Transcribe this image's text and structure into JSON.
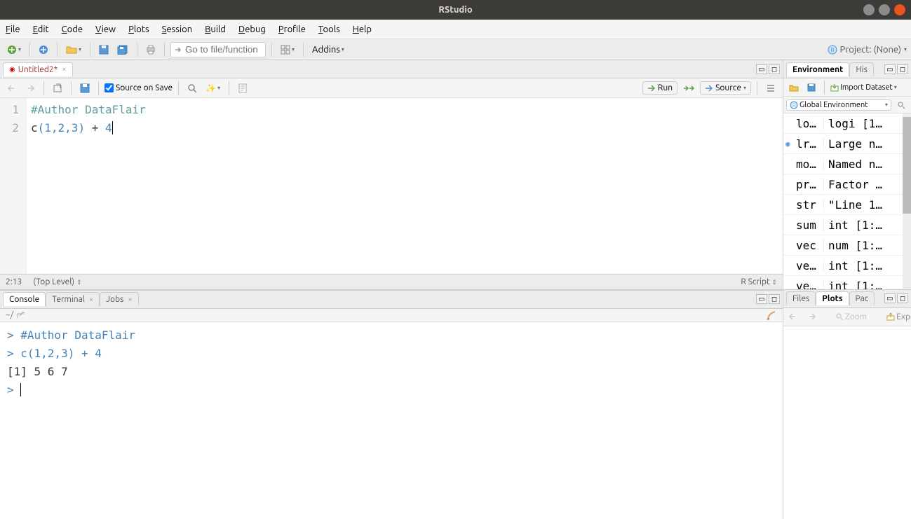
{
  "window": {
    "title": "RStudio"
  },
  "menu": {
    "file": "File",
    "edit": "Edit",
    "code": "Code",
    "view": "View",
    "plots": "Plots",
    "session": "Session",
    "build": "Build",
    "debug": "Debug",
    "profile": "Profile",
    "tools": "Tools",
    "help": "Help"
  },
  "toolbar": {
    "goto_placeholder": "Go to file/function",
    "addins": "Addins",
    "project_label": "Project: (None)"
  },
  "source": {
    "tab_name": "Untitled2*",
    "source_on_save": "Source on Save",
    "run": "Run",
    "source_btn": "Source",
    "line1": "#Author DataFlair",
    "line2_func": "c",
    "line2_args": "(1,2,3)",
    "line2_op": " + ",
    "line2_num": "4",
    "status_pos": "2:13",
    "status_scope": "(Top Level)",
    "status_type": "R Script"
  },
  "console": {
    "tab_console": "Console",
    "tab_terminal": "Terminal",
    "tab_jobs": "Jobs",
    "path": "~/",
    "lines": [
      {
        "type": "cmd",
        "text": "#Author DataFlair"
      },
      {
        "type": "cmd",
        "text": "c(1,2,3) + 4"
      },
      {
        "type": "out",
        "text": "[1] 5 6 7"
      },
      {
        "type": "prompt",
        "text": ""
      }
    ]
  },
  "env": {
    "tab_env": "Environment",
    "tab_hist": "His",
    "import": "Import Dataset",
    "scope": "Global Environment",
    "vars": [
      {
        "name": "lo…",
        "val": "logi [1…",
        "expand": false
      },
      {
        "name": "lr…",
        "val": "Large n…",
        "expand": true
      },
      {
        "name": "mo…",
        "val": "Named n…",
        "expand": false
      },
      {
        "name": "pr…",
        "val": "Factor …",
        "expand": false
      },
      {
        "name": "str",
        "val": "\"Line 1…",
        "expand": false
      },
      {
        "name": "sum",
        "val": "int [1:…",
        "expand": false
      },
      {
        "name": "vec",
        "val": "num [1:…",
        "expand": false
      },
      {
        "name": "ve…",
        "val": "int [1:…",
        "expand": false
      },
      {
        "name": "ve…",
        "val": "int [1:…",
        "expand": false
      }
    ]
  },
  "plots": {
    "tab_files": "Files",
    "tab_plots": "Plots",
    "tab_pac": "Pac",
    "zoom": "Zoom",
    "export": "Expo"
  }
}
